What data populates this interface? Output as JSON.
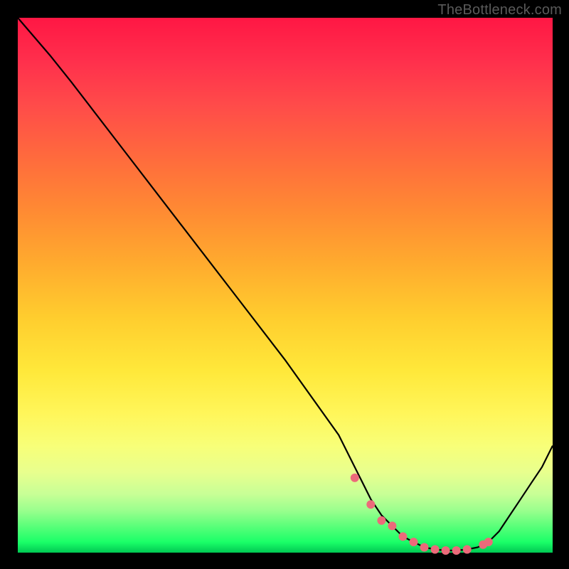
{
  "watermark": {
    "text": "TheBottleneck.com"
  },
  "colors": {
    "curve": "#000000",
    "marker": "#ec6a7a"
  },
  "chart_data": {
    "type": "line",
    "title": "",
    "xlabel": "",
    "ylabel": "",
    "xlim": [
      0,
      100
    ],
    "ylim": [
      0,
      100
    ],
    "grid": false,
    "series": [
      {
        "name": "curve",
        "x": [
          0,
          6,
          10,
          20,
          30,
          40,
          50,
          60,
          62,
          64,
          66,
          68,
          70,
          72,
          74,
          76,
          78,
          80,
          82,
          84,
          86,
          88,
          90,
          92,
          94,
          96,
          98,
          100
        ],
        "values": [
          100,
          93,
          88,
          75,
          62,
          49,
          36,
          22,
          18,
          14,
          10,
          7,
          5,
          3,
          2,
          1,
          0.6,
          0.4,
          0.4,
          0.6,
          1,
          2,
          4,
          7,
          10,
          13,
          16,
          20
        ]
      }
    ],
    "markers": {
      "name": "highlight",
      "x": [
        63,
        66,
        68,
        70,
        72,
        74,
        76,
        78,
        80,
        82,
        84,
        87,
        88
      ],
      "values": [
        14,
        9,
        6,
        5,
        3,
        2,
        1,
        0.6,
        0.4,
        0.4,
        0.6,
        1.5,
        2
      ]
    }
  }
}
